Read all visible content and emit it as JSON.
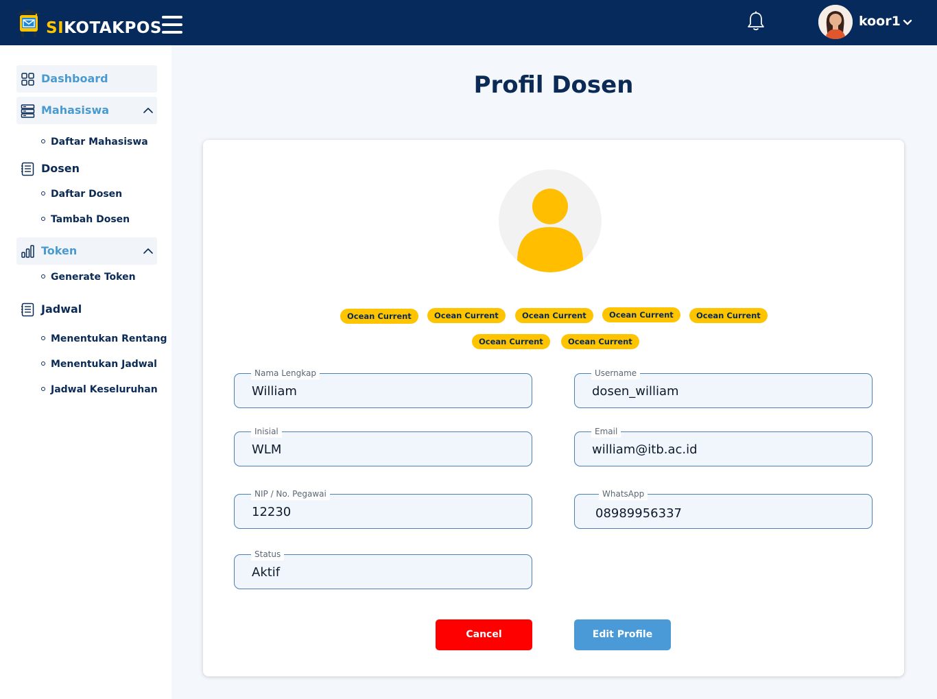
{
  "header": {
    "brand_prefix": "SI",
    "brand_suffix": "KOTAKPOS",
    "username": "koor1"
  },
  "sidebar": {
    "dashboard": "Dashboard",
    "mahasiswa": "Mahasiswa",
    "mahasiswa_sub": [
      "Daftar Mahasiswa"
    ],
    "dosen": "Dosen",
    "dosen_sub": [
      "Daftar Dosen",
      "Tambah Dosen"
    ],
    "token": "Token",
    "token_sub": [
      "Generate Token"
    ],
    "jadwal": "Jadwal",
    "jadwal_sub": [
      "Menentukan Rentang",
      "Menentukan Jadwal",
      "Jadwal Keseluruhan"
    ]
  },
  "main": {
    "title": "Profil Dosen",
    "tags": [
      "Ocean Current",
      "Ocean Current",
      "Ocean Current",
      "Ocean Current",
      "Ocean Current",
      "Ocean Current",
      "Ocean Current"
    ],
    "fields": {
      "nama": {
        "label": "Nama Lengkap",
        "value": "William"
      },
      "username": {
        "label": "Username",
        "value": "dosen_william"
      },
      "inisial": {
        "label": "Inisial",
        "value": "WLM"
      },
      "email": {
        "label": "Email",
        "value": "william@itb.ac.id"
      },
      "nip": {
        "label": "NIP / No. Pegawai",
        "value": "12230"
      },
      "whatsapp": {
        "label": "WhatsApp",
        "value": "08989956337"
      },
      "status": {
        "label": "Status",
        "value": "Aktif"
      }
    },
    "cancel_label": "Cancel",
    "edit_label": "Edit Profile"
  },
  "colors": {
    "header_bg": "#062A5C",
    "accent_yellow": "#FFC400",
    "link_blue": "#4A9AD0",
    "cancel_red": "#FF0000",
    "edit_blue": "#4A9AD8"
  }
}
